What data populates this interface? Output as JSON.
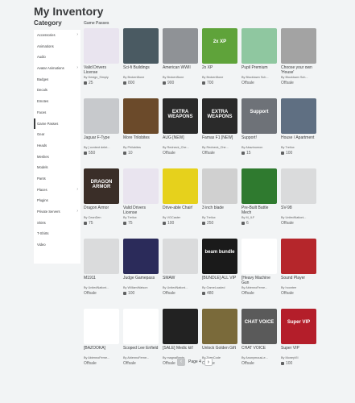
{
  "page": {
    "title": "My Inventory",
    "category_title": "Category",
    "section_title": "Game Passes"
  },
  "sidebar": {
    "items": [
      {
        "label": "Accessories",
        "chevron": true
      },
      {
        "label": "Animations",
        "chevron": false
      },
      {
        "label": "Audio",
        "chevron": false
      },
      {
        "label": "Avatar Animations",
        "chevron": true
      },
      {
        "label": "Badges",
        "chevron": false
      },
      {
        "label": "Decals",
        "chevron": false
      },
      {
        "label": "Emotes",
        "chevron": false
      },
      {
        "label": "Faces",
        "chevron": false
      },
      {
        "label": "Game Passes",
        "chevron": false,
        "active": true
      },
      {
        "label": "Gear",
        "chevron": false
      },
      {
        "label": "Heads",
        "chevron": false
      },
      {
        "label": "Meshes",
        "chevron": false
      },
      {
        "label": "Models",
        "chevron": false
      },
      {
        "label": "Pants",
        "chevron": false
      },
      {
        "label": "Places",
        "chevron": true
      },
      {
        "label": "Plugins",
        "chevron": false
      },
      {
        "label": "Private Servers",
        "chevron": true
      },
      {
        "label": "Shirts",
        "chevron": false
      },
      {
        "label": "T-Shirts",
        "chevron": false
      },
      {
        "label": "Video",
        "chevron": false
      }
    ]
  },
  "items": [
    {
      "name": "Valid Drivers License",
      "creator": "By Design_Simply",
      "price": "25",
      "thumb": "#e9e4ef",
      "icon": "license-card-icon"
    },
    {
      "name": "Sci-fi Buildings",
      "creator": "By BrokenBone",
      "price": "800",
      "thumb": "#4a5a62",
      "icon": "scifi-buildings-icon"
    },
    {
      "name": "American WWII",
      "creator": "By BrokenBone",
      "price": "900",
      "thumb": "#8f9296",
      "icon": "wwii-buildings-icon"
    },
    {
      "name": "2x XP",
      "creator": "By BrokenBone",
      "price": "700",
      "thumb": "#5fa33a",
      "icon": "xp-icon",
      "caption": "2x XP"
    },
    {
      "name": "Pupil Premium",
      "creator": "By Blocktown Sch...",
      "price": "Offsale",
      "thumb": "#8fc7a0",
      "icon": "premium-icon"
    },
    {
      "name": "Choose your own 'House'",
      "creator": "By Blocktown Sch...",
      "price": "Offsale",
      "thumb": "#a3a3a3",
      "icon": "house-logo-icon"
    },
    {
      "name": "Jaguar F-Type",
      "creator": "By [ content delet...",
      "price": "550",
      "thumb": "#c7c9cc",
      "icon": "car-icon"
    },
    {
      "name": "More Trilobites",
      "creator": "By Philobites",
      "price": "10",
      "thumb": "#6b4a2a",
      "icon": "trilobite-icon"
    },
    {
      "name": "AUG [NEW]",
      "creator": "By Redneck_Che...",
      "price": "Offsale",
      "thumb": "#2a2a2a",
      "icon": "extra-weapons-icon",
      "caption": "EXTRA WEAPONS"
    },
    {
      "name": "Famas F1 [NEW]",
      "creator": "By Redneck_Che...",
      "price": "Offsale",
      "thumb": "#2a2a2a",
      "icon": "extra-weapons-icon",
      "caption": "EXTRA WEAPONS"
    },
    {
      "name": "Support!",
      "creator": "By Abazinomon",
      "price": "15",
      "thumb": "#6e7278",
      "icon": "support-icon",
      "caption": "Support"
    },
    {
      "name": "House / Apartment",
      "creator": "By Treilux",
      "price": "100",
      "thumb": "#5f6f82",
      "icon": "for-sale-icon"
    },
    {
      "name": "Dragon Armor",
      "creator": "By CeanDen",
      "price": "75",
      "thumb": "#3a2e28",
      "icon": "dragon-armor-icon",
      "caption": "DRAGON ARMOR"
    },
    {
      "name": "Valid Drivers License",
      "creator": "By Treilux",
      "price": "75",
      "thumb": "#e9e4ef",
      "icon": "license-card-icon"
    },
    {
      "name": "Drive-able Chair!",
      "creator": "By VGCaster",
      "price": "100",
      "thumb": "#e6d11c",
      "icon": "chair-icon"
    },
    {
      "name": "3 inch blade",
      "creator": "By Treilux",
      "price": "250",
      "thumb": "#d0d0d0",
      "icon": "blade-icon"
    },
    {
      "name": "Pre-Built Battle Mech",
      "creator": "By M_ILF",
      "price": "6",
      "thumb": "#2f7a2f",
      "icon": "mech-icon"
    },
    {
      "name": "SV-98",
      "creator": "By UnitedNationi...",
      "price": "Offsale",
      "thumb": "#dadbdc",
      "icon": "rifle-icon"
    },
    {
      "name": "M1911",
      "creator": "By UnitedNationi...",
      "price": "Offsale",
      "thumb": "#dadbdc",
      "icon": "pistol-icon"
    },
    {
      "name": "Judge Gamepass",
      "creator": "By WilliamWatson",
      "price": "100",
      "thumb": "#2b2b5a",
      "icon": "judge-icon"
    },
    {
      "name": "SMAW",
      "creator": "By UnitedNationi...",
      "price": "Offsale",
      "thumb": "#dadbdc",
      "icon": "launcher-icon"
    },
    {
      "name": "[BUNDLE] ALL VIP",
      "creator": "By GameLoaded",
      "price": "480",
      "thumb": "#1a1a1a",
      "icon": "beam-bundle-icon",
      "caption": "beam bundle"
    },
    {
      "name": "[Heavy Machine Gun",
      "creator": "By AbiennoFerne...",
      "price": "Offsale",
      "thumb": "#ffffff",
      "icon": "uk-flag-icon"
    },
    {
      "name": "Sound Player",
      "creator": "By hoontee",
      "price": "Offsale",
      "thumb": "#b5262b",
      "icon": "sound-player-icon"
    },
    {
      "name": "[BAZOOKA]",
      "creator": "By AbiennoFerne...",
      "price": "Offsale",
      "thumb": "#ffffff",
      "icon": "us-flag-icon"
    },
    {
      "name": "Scoped Lee Enfield",
      "creator": "By AbiennoFerne...",
      "price": "Offsale",
      "thumb": "#ffffff",
      "icon": "uk-flag-icon"
    },
    {
      "name": "[SALE] Medic kit!",
      "creator": "By magnaBenta",
      "price": "Offsale",
      "thumb": "#222222",
      "icon": "medic-cross-icon"
    },
    {
      "name": "Unlock Golden Gift",
      "creator": "By TigerCode",
      "price": "Offsale",
      "thumb": "#7a6a3a",
      "icon": "golden-gift-icon"
    },
    {
      "name": "CHAT VOICE",
      "creator": "By AnonymousLe...",
      "price": "Offsale",
      "thumb": "#5a5a5a",
      "icon": "chat-voice-icon",
      "caption": "CHAT VOICE"
    },
    {
      "name": "Super VIP",
      "creator": "By MoneyVII",
      "price": "100",
      "thumb": "#b41e2a",
      "icon": "super-vip-icon",
      "caption": "Super VIP"
    }
  ],
  "pager": {
    "label": "Page 4"
  }
}
